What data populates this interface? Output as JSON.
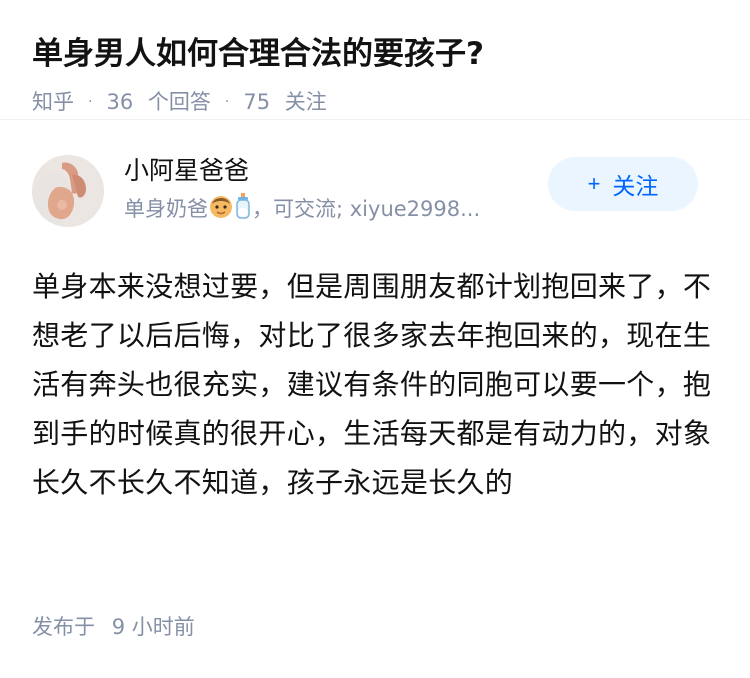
{
  "question": {
    "title": "单身男人如何合理合法的要孩子?",
    "source": "知乎",
    "answers_count": "36",
    "answers_label": "个回答",
    "followers_count": "75",
    "followers_label": "关注"
  },
  "answer": {
    "author": {
      "name": "小阿星爸爸",
      "bio_prefix": "单身奶爸",
      "bio_suffix": "，可交流; xiyue2998...",
      "bio_icons": [
        "baby-face-icon",
        "baby-bottle-icon"
      ]
    },
    "follow_button": {
      "icon": "plus-icon",
      "label": "关注"
    },
    "content": "单身本来没想过要，但是周围朋友都计划抱回来了，不想老了以后后悔，对比了很多家去年抱回来的，现在生活有奔头也很充实，建议有条件的同胞可以要一个，抱到手的时候真的很开心，生活每天都是有动力的，对象长久不长久不知道，孩子永远是长久的",
    "published_prefix": "发布于",
    "published_time": "9 小时前"
  },
  "colors": {
    "text": "#121212",
    "meta": "#8590a6",
    "accent": "#0066ff",
    "follow_bg": "#ebf5ff"
  }
}
